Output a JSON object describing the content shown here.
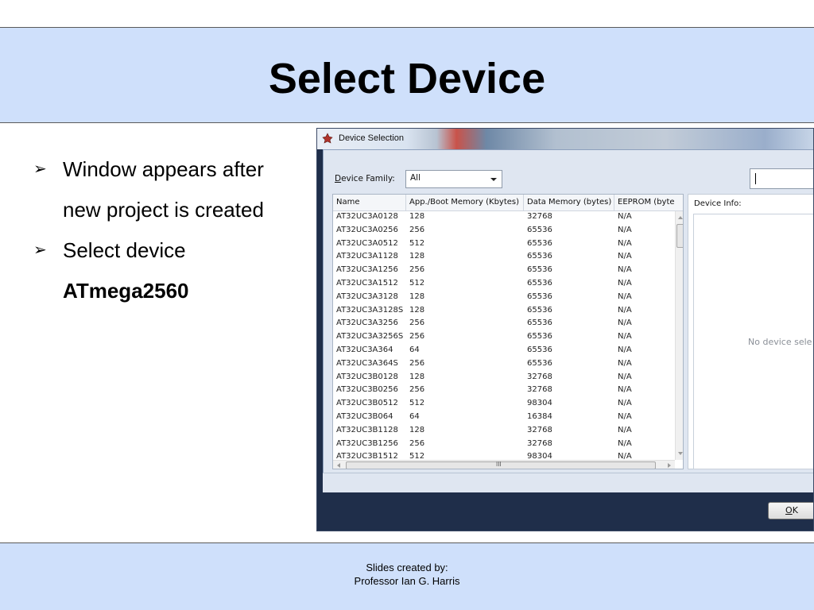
{
  "slide": {
    "title": "Select Device",
    "bullets": [
      {
        "lines": [
          "Window appears after",
          "new project is created"
        ],
        "bold": false
      },
      {
        "lines": [
          "Select device"
        ],
        "bold_line": "ATmega2560"
      }
    ],
    "credit_line1": "Slides created by:",
    "credit_line2": "Professor Ian G. Harris"
  },
  "window": {
    "title": "Device Selection",
    "device_family_label_u": "D",
    "device_family_label_rest": "evice Family:",
    "device_family_value": "All",
    "search_value": "",
    "columns": [
      "Name",
      "App./Boot Memory (Kbytes)",
      "Data Memory (bytes)",
      "EEPROM (byte"
    ],
    "rows": [
      [
        "AT32UC3A0128",
        "128",
        "32768",
        "N/A"
      ],
      [
        "AT32UC3A0256",
        "256",
        "65536",
        "N/A"
      ],
      [
        "AT32UC3A0512",
        "512",
        "65536",
        "N/A"
      ],
      [
        "AT32UC3A1128",
        "128",
        "65536",
        "N/A"
      ],
      [
        "AT32UC3A1256",
        "256",
        "65536",
        "N/A"
      ],
      [
        "AT32UC3A1512",
        "512",
        "65536",
        "N/A"
      ],
      [
        "AT32UC3A3128",
        "128",
        "65536",
        "N/A"
      ],
      [
        "AT32UC3A3128S",
        "128",
        "65536",
        "N/A"
      ],
      [
        "AT32UC3A3256",
        "256",
        "65536",
        "N/A"
      ],
      [
        "AT32UC3A3256S",
        "256",
        "65536",
        "N/A"
      ],
      [
        "AT32UC3A364",
        "64",
        "65536",
        "N/A"
      ],
      [
        "AT32UC3A364S",
        "256",
        "65536",
        "N/A"
      ],
      [
        "AT32UC3B0128",
        "128",
        "32768",
        "N/A"
      ],
      [
        "AT32UC3B0256",
        "256",
        "32768",
        "N/A"
      ],
      [
        "AT32UC3B0512",
        "512",
        "98304",
        "N/A"
      ],
      [
        "AT32UC3B064",
        "64",
        "16384",
        "N/A"
      ],
      [
        "AT32UC3B1128",
        "128",
        "32768",
        "N/A"
      ],
      [
        "AT32UC3B1256",
        "256",
        "32768",
        "N/A"
      ],
      [
        "AT32UC3B1512",
        "512",
        "98304",
        "N/A"
      ]
    ],
    "device_info_label": "Device Info:",
    "no_device_text": "No device sele",
    "ok_u": "O",
    "ok_rest": "K",
    "scroll_grip": "III"
  }
}
